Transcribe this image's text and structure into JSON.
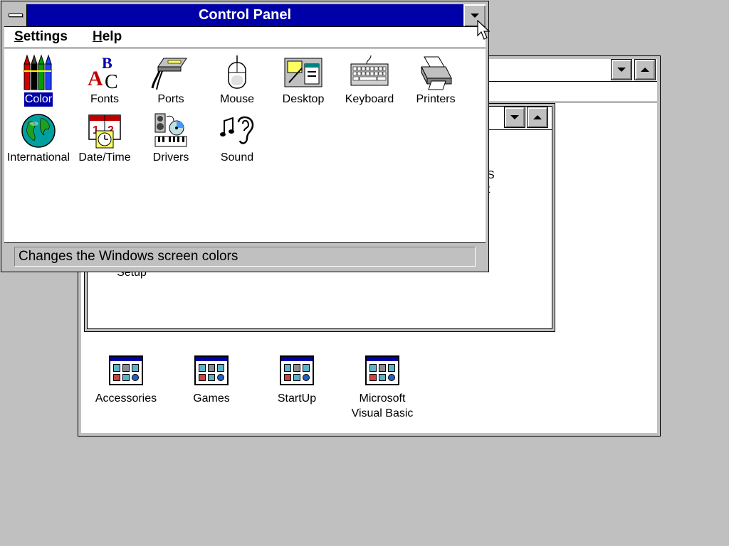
{
  "control_panel": {
    "title": "Control Panel",
    "menu": [
      {
        "label": "Settings",
        "mnemonic": "S",
        "rest": "ettings"
      },
      {
        "label": "Help",
        "mnemonic": "H",
        "rest": "elp"
      }
    ],
    "icons": [
      {
        "label": "Color",
        "icon": "color-crayons-icon",
        "selected": true
      },
      {
        "label": "Fonts",
        "icon": "fonts-icon"
      },
      {
        "label": "Ports",
        "icon": "ports-icon"
      },
      {
        "label": "Mouse",
        "icon": "mouse-icon"
      },
      {
        "label": "Desktop",
        "icon": "desktop-icon"
      },
      {
        "label": "Keyboard",
        "icon": "keyboard-icon"
      },
      {
        "label": "Printers",
        "icon": "printer-icon"
      },
      {
        "label": "International",
        "icon": "globe-icon"
      },
      {
        "label": "Date/Time",
        "icon": "calendar-clock-icon"
      },
      {
        "label": "Drivers",
        "icon": "drivers-icon"
      },
      {
        "label": "Sound",
        "icon": "sound-icon"
      }
    ],
    "status": "Changes the Windows screen colors"
  },
  "program_manager": {
    "main_group": {
      "visible_labels": [
        "Setup"
      ],
      "clipped_labels": [
        "S",
        "t"
      ]
    },
    "group_icons": [
      {
        "label_line1": "Accessories",
        "label_line2": ""
      },
      {
        "label_line1": "Games",
        "label_line2": ""
      },
      {
        "label_line1": "StartUp",
        "label_line2": ""
      },
      {
        "label_line1": "Microsoft",
        "label_line2": "Visual Basic"
      }
    ]
  },
  "colors": {
    "desktop": "#c0c0c0",
    "active_title": "#0000a8",
    "selection": "#0000a8"
  }
}
